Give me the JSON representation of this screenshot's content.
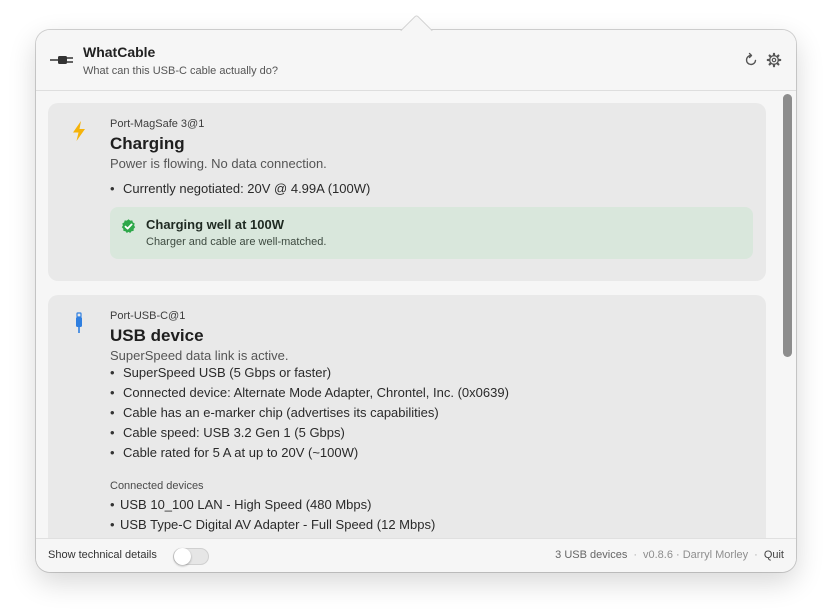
{
  "header": {
    "title": "WhatCable",
    "subtitle": "What can this USB-C cable actually do?",
    "icons": {
      "app": "cable-plug-icon",
      "refresh": "refresh-icon",
      "settings": "gear-icon"
    }
  },
  "ports": [
    {
      "port_name": "Port-MagSafe 3@1",
      "icon": "lightning-bolt-icon",
      "title": "Charging",
      "description": "Power is flowing. No data connection.",
      "bullets": [
        "Currently negotiated: 20V @ 4.99A (100W)"
      ],
      "status": {
        "icon": "checkmark-badge-icon",
        "title": "Charging well at 100W",
        "subtitle": "Charger and cable are well-matched."
      }
    },
    {
      "port_name": "Port-USB-C@1",
      "icon": "usb-plug-icon",
      "title": "USB device",
      "description": "SuperSpeed data link is active.",
      "bullets": [
        "SuperSpeed USB (5 Gbps or faster)",
        "Connected device: Alternate Mode Adapter, Chrontel, Inc. (0x0639)",
        "Cable has an e-marker chip (advertises its capabilities)",
        "Cable speed: USB 3.2 Gen 1 (5 Gbps)",
        "Cable rated for 5 A at up to 20V (~100W)"
      ],
      "connected_heading": "Connected devices",
      "connected_devices": [
        "USB 10_100 LAN - High Speed (480 Mbps)",
        "USB Type-C Digital AV Adapter - Full Speed (12 Mbps)"
      ]
    }
  ],
  "footer": {
    "tech_details_label": "Show technical details",
    "tech_details_enabled": false,
    "device_count": "3 USB devices",
    "separator": "·",
    "version_author": "v0.8.6 · Darryl Morley",
    "quit_label": "Quit"
  },
  "colors": {
    "accent_bolt": "#f5b30a",
    "success_green": "#2ea84a",
    "status_bg": "#d9e7dc",
    "usb_blue": "#2f7fe0",
    "card_bg": "#e9e9e9"
  }
}
